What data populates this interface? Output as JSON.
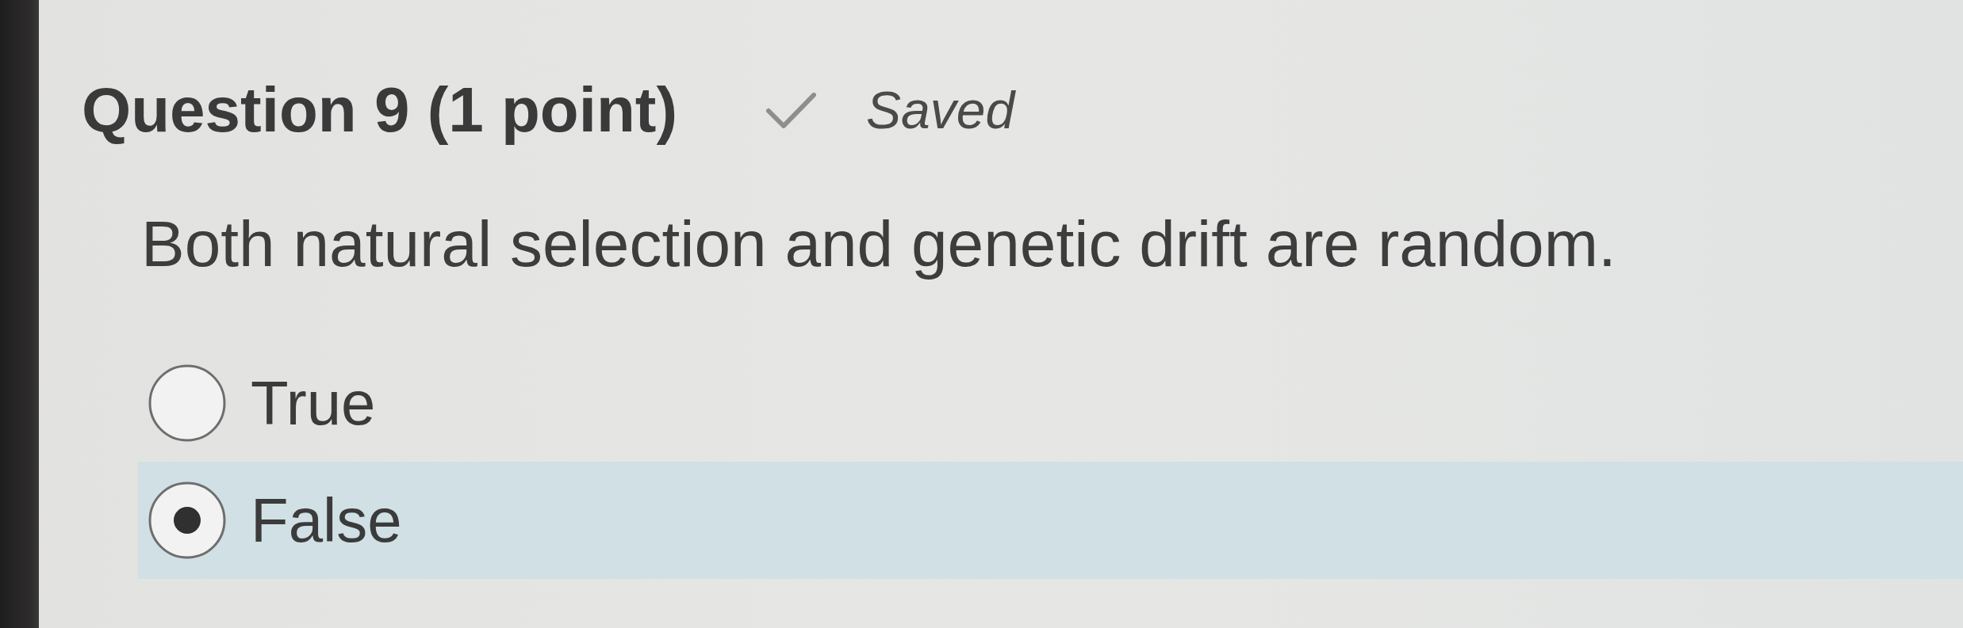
{
  "question": {
    "title": "Question 9 (1 point)",
    "save_status": {
      "saved": true,
      "label": "Saved"
    },
    "prompt": "Both natural selection and genetic drift are random.",
    "options": [
      {
        "label": "True",
        "selected": false
      },
      {
        "label": "False",
        "selected": true
      }
    ]
  }
}
